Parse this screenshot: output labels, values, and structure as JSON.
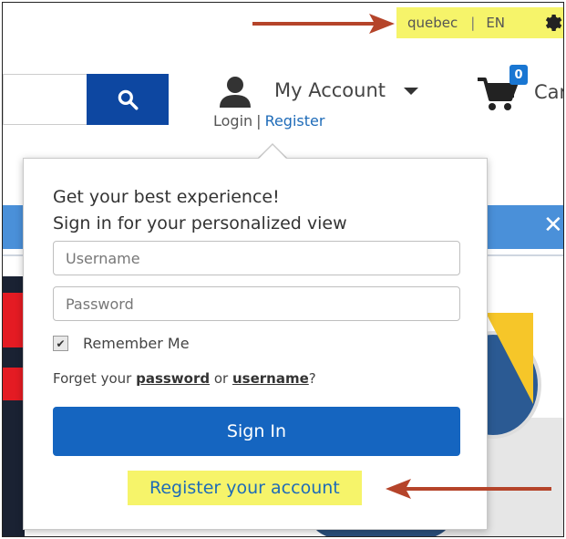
{
  "topbar": {
    "region": "quebec",
    "separator": "|",
    "language": "EN",
    "gear_icon": "gear-icon"
  },
  "header": {
    "search_icon": "search-icon",
    "account_label": "My Account",
    "login_label": "Login",
    "pipe": "|",
    "register_label": "Register",
    "cart_count": "0",
    "cart_label": "Car"
  },
  "notice": {
    "close_glyph": "✕"
  },
  "dropdown": {
    "line1": "Get your best experience!",
    "line2": "Sign in for your personalized view",
    "username_placeholder": "Username",
    "password_placeholder": "Password",
    "remember_label": "Remember Me",
    "remember_checked": true,
    "forget_prefix": "Forget your ",
    "password_link": "password",
    "or_text": " or ",
    "username_link": "username",
    "forget_suffix": "?",
    "signin_label": "Sign In",
    "register_account_label": "Register your account"
  },
  "colors": {
    "highlight": "#f6f46a",
    "primary_blue": "#1565c0",
    "link_blue": "#1e6bb8",
    "arrow_red": "#b5442a"
  }
}
